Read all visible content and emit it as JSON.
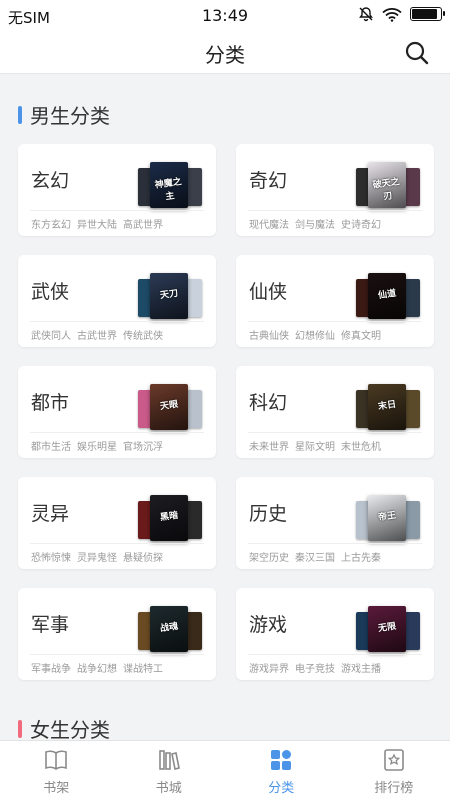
{
  "status_bar": {
    "carrier": "无SIM",
    "time": "13:49",
    "battery_level": 0.9
  },
  "header": {
    "title": "分类",
    "search_icon": "search-icon"
  },
  "colors": {
    "accent": "#4b94e8",
    "male_bar": "#4b94e8",
    "female_bar": "#ef6b7d",
    "tag_text": "#9a9a9a"
  },
  "sections": [
    {
      "title": "男生分类",
      "categories": [
        {
          "name": "玄幻",
          "tags": [
            "东方玄幻",
            "异世大陆",
            "高武世界"
          ],
          "cover_colors": [
            "#2a2f3a",
            "#1b2b48",
            "#3a3f4a"
          ],
          "cover_text": "神魔之主"
        },
        {
          "name": "奇幻",
          "tags": [
            "现代魔法",
            "剑与魔法",
            "史诗奇幻"
          ],
          "cover_colors": [
            "#2d2d2d",
            "#e8e4ea",
            "#5a3a4a"
          ],
          "cover_text": "破天之刃"
        },
        {
          "name": "武侠",
          "tags": [
            "武侠同人",
            "古武世界",
            "传统武侠"
          ],
          "cover_colors": [
            "#1d4a66",
            "#2b3a55",
            "#c9d2dc"
          ],
          "cover_text": "天刀"
        },
        {
          "name": "仙侠",
          "tags": [
            "古典仙侠",
            "幻想修仙",
            "修真文明"
          ],
          "cover_colors": [
            "#3b1a14",
            "#1a1010",
            "#2a3a4a"
          ],
          "cover_text": "仙道"
        },
        {
          "name": "都市",
          "tags": [
            "都市生活",
            "娱乐明星",
            "官场沉浮"
          ],
          "cover_colors": [
            "#c95a8a",
            "#6a3a2a",
            "#b9c2cc"
          ],
          "cover_text": "天眼"
        },
        {
          "name": "科幻",
          "tags": [
            "未来世界",
            "星际文明",
            "末世危机"
          ],
          "cover_colors": [
            "#3a3222",
            "#4a3a22",
            "#5a4a2a"
          ],
          "cover_text": "末日"
        },
        {
          "name": "灵异",
          "tags": [
            "恐怖惊悚",
            "灵异鬼怪",
            "悬疑侦探"
          ],
          "cover_colors": [
            "#6a1a1a",
            "#1c1c22",
            "#2a2a2a"
          ],
          "cover_text": "黑暗"
        },
        {
          "name": "历史",
          "tags": [
            "架空历史",
            "秦汉三国",
            "上古先秦"
          ],
          "cover_colors": [
            "#b8c2cc",
            "#e9ecef",
            "#8a9aa6"
          ],
          "cover_text": "帝王"
        },
        {
          "name": "军事",
          "tags": [
            "军事战争",
            "战争幻想",
            "谍战特工"
          ],
          "cover_colors": [
            "#6a4a22",
            "#1e2a2e",
            "#3a2a1a"
          ],
          "cover_text": "战魂"
        },
        {
          "name": "游戏",
          "tags": [
            "游戏异界",
            "电子竞技",
            "游戏主播"
          ],
          "cover_colors": [
            "#1a3a5a",
            "#5a1a3a",
            "#2a3a5a"
          ],
          "cover_text": "无限"
        }
      ]
    },
    {
      "title": "女生分类",
      "categories": []
    }
  ],
  "tabbar": {
    "items": [
      {
        "label": "书架",
        "icon": "bookshelf-icon",
        "active": false
      },
      {
        "label": "书城",
        "icon": "library-icon",
        "active": false
      },
      {
        "label": "分类",
        "icon": "category-grid-icon",
        "active": true
      },
      {
        "label": "排行榜",
        "icon": "ranking-icon",
        "active": false
      }
    ]
  }
}
